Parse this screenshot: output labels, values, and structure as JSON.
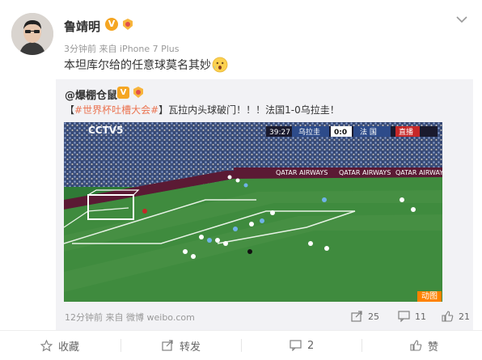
{
  "post": {
    "username": "鲁靖明",
    "verified_badge": "V",
    "level_icon": "level-badge-icon",
    "time": "3分钟前",
    "source_prefix": "来自",
    "source": "iPhone 7 Plus",
    "text": "本坦库尔给的任意球莫名其妙",
    "emoji": "surprised-face-emoji",
    "menu_icon": "chevron-down-icon"
  },
  "repost": {
    "username": "@爆棚仓鼠",
    "verified_badge": "V",
    "text_open": "【",
    "hashtag": "#世界杯吐槽大会#",
    "text_close": "】瓦拉内头球破门！！！法国1-0乌拉圭！",
    "video": {
      "channel_logo": "CCTV5",
      "clock": "39:27",
      "team_home": "乌拉圭",
      "score": "0:0",
      "team_away": "法 国",
      "live_label": "直播",
      "sponsor": "QATAR AIRWAYS",
      "gif_badge": "动图"
    },
    "time": "12分钟前",
    "source_prefix": "来自",
    "source": "微博 weibo.com",
    "stats": {
      "reposts": "25",
      "comments": "11",
      "likes": "21"
    }
  },
  "actions": {
    "favorite": "收藏",
    "forward": "转发",
    "comment": "2",
    "like": "赞"
  },
  "colors": {
    "hashtag": "#eb7350",
    "vip_badge": "#f5a623",
    "gif_badge": "#ff8200",
    "repost_bg": "#f2f2f5"
  }
}
